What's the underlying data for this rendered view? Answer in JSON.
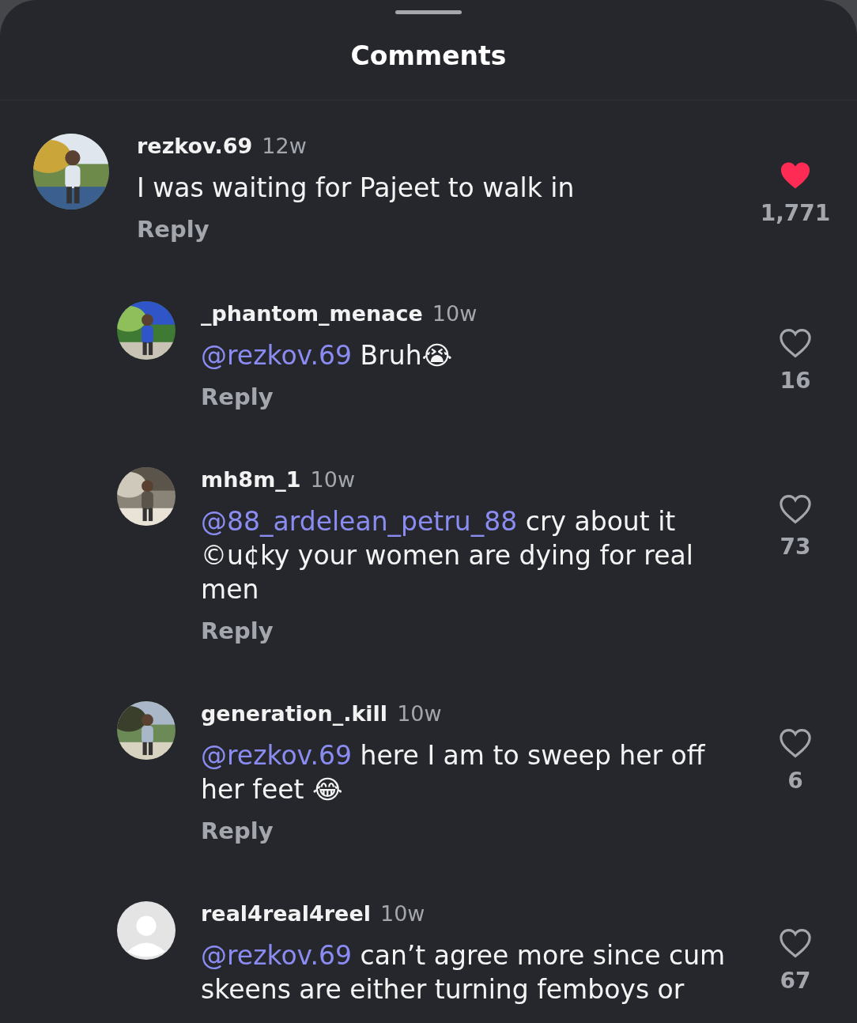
{
  "sheet": {
    "title": "Comments"
  },
  "comments": [
    {
      "username": "rezkov.69",
      "time": "12w",
      "text": "I was waiting for Pajeet to walk in",
      "reply": "Reply",
      "likes": "1,771",
      "liked": true,
      "children": [
        {
          "username": "_phantom_menace",
          "time": "10w",
          "mention": "@rezkov.69",
          "text": "Bruh😭",
          "reply": "Reply",
          "likes": "16",
          "liked": false
        },
        {
          "username": "mh8m_1",
          "time": "10w",
          "mention": "@88_ardelean_petru_88",
          "text": "cry about it ©u¢ky your women are dying for real men",
          "reply": "Reply",
          "likes": "73",
          "liked": false
        },
        {
          "username": "generation_.kill",
          "time": "10w",
          "mention": "@rezkov.69",
          "text": " here I am to sweep her off her feet 😂",
          "reply": "Reply",
          "likes": "6",
          "liked": false
        },
        {
          "username": "real4real4reel",
          "time": "10w",
          "mention": "@rezkov.69",
          "text": "can’t agree more since cum skeens are either turning femboys or",
          "likes": "67",
          "liked": false,
          "avatar": {
            "kind": "default"
          }
        }
      ]
    }
  ]
}
